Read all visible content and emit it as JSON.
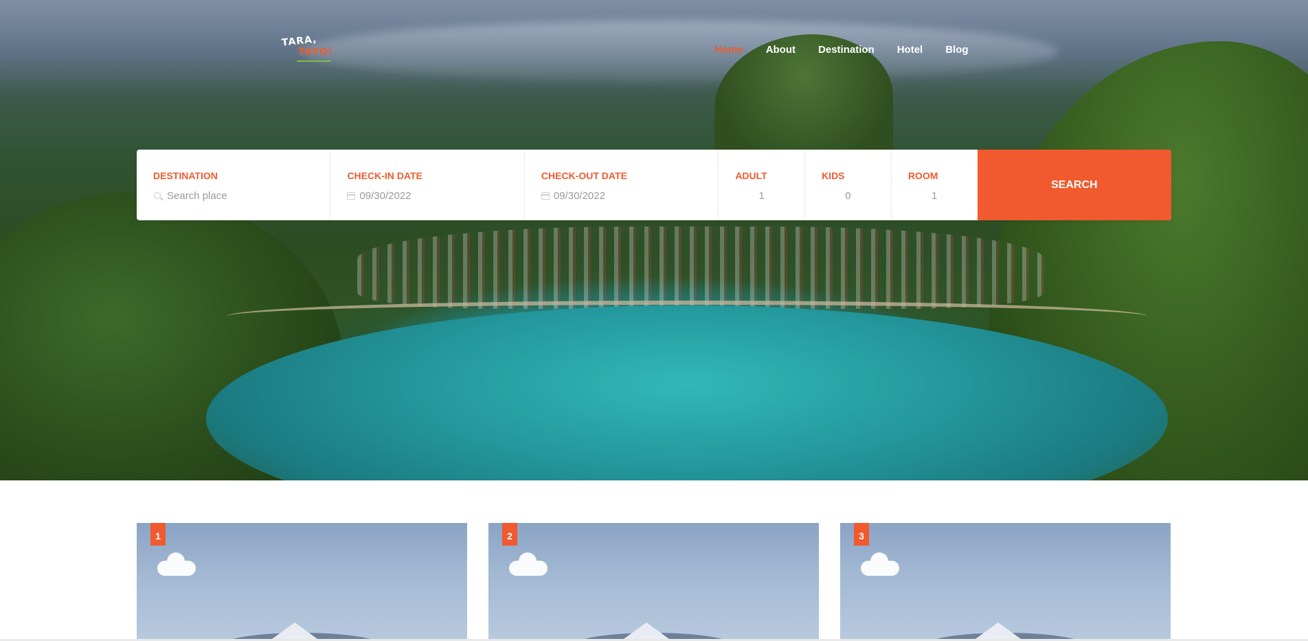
{
  "logo": {
    "line1": "TARA,",
    "line2": "TAYO!"
  },
  "nav": {
    "items": [
      {
        "label": "Home",
        "active": true
      },
      {
        "label": "About",
        "active": false
      },
      {
        "label": "Destination",
        "active": false
      },
      {
        "label": "Hotel",
        "active": false
      },
      {
        "label": "Blog",
        "active": false
      }
    ]
  },
  "search": {
    "destination": {
      "label": "DESTINATION",
      "placeholder": "Search place",
      "icon": "search-icon"
    },
    "checkin": {
      "label": "CHECK-IN DATE",
      "value": "09/30/2022",
      "icon": "calendar-icon"
    },
    "checkout": {
      "label": "CHECK-OUT DATE",
      "value": "09/30/2022",
      "icon": "calendar-icon"
    },
    "adult": {
      "label": "ADULT",
      "value": "1"
    },
    "kids": {
      "label": "KIDS",
      "value": "0"
    },
    "room": {
      "label": "ROOM",
      "value": "1"
    },
    "button_label": "SEARCH"
  },
  "cards": [
    {
      "rank": "1"
    },
    {
      "rank": "2"
    },
    {
      "rank": "3"
    }
  ],
  "colors": {
    "accent": "#f05a2e",
    "label_orange": "#ee5a2f",
    "nav_text": "#ffffff",
    "value_gray": "#9a9a9a"
  }
}
